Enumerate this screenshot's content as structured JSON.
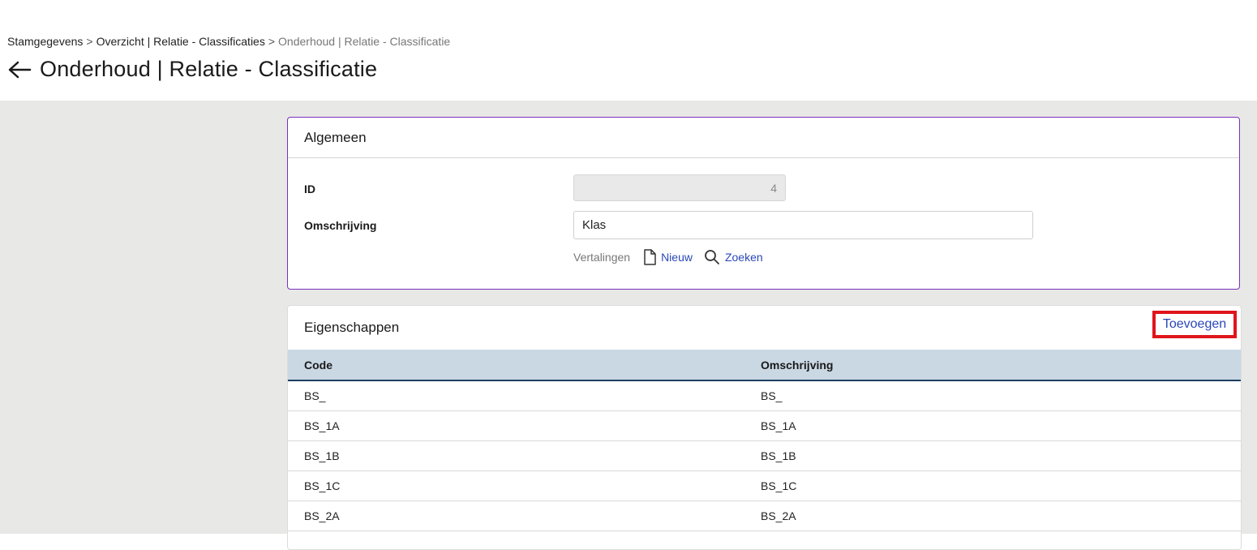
{
  "breadcrumb": {
    "items": [
      "Stamgegevens",
      "Overzicht | Relatie - Classificaties"
    ],
    "current": "Onderhoud | Relatie - Classificatie",
    "separator": ">"
  },
  "page": {
    "title": "Onderhoud | Relatie - Classificatie"
  },
  "general": {
    "title": "Algemeen",
    "id_label": "ID",
    "id_value": "4",
    "description_label": "Omschrijving",
    "description_value": "Klas",
    "translations_label": "Vertalingen",
    "new_label": "Nieuw",
    "search_label": "Zoeken"
  },
  "properties": {
    "title": "Eigenschappen",
    "add_label": "Toevoegen",
    "columns": [
      "Code",
      "Omschrijving"
    ],
    "rows": [
      [
        "BS_",
        "BS_"
      ],
      [
        "BS_1A",
        "BS_1A"
      ],
      [
        "BS_1B",
        "BS_1B"
      ],
      [
        "BS_1C",
        "BS_1C"
      ],
      [
        "BS_2A",
        "BS_2A"
      ]
    ]
  },
  "colors": {
    "accent_link": "#2a47b8",
    "card_border_active": "#7b2fbe",
    "highlight_box": "#e0151c",
    "table_header_bg": "#cad8e4"
  }
}
